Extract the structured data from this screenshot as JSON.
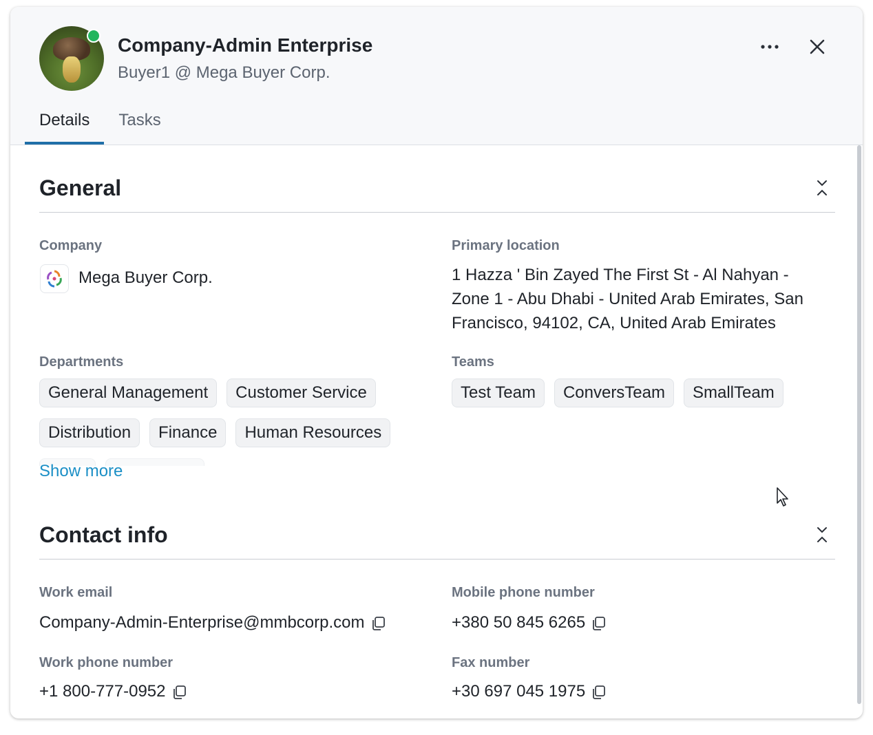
{
  "header": {
    "name": "Company-Admin Enterprise",
    "subtitle": "Buyer1 @ Mega Buyer Corp.",
    "status_color": "#23b55e"
  },
  "tabs": [
    {
      "label": "Details",
      "active": true
    },
    {
      "label": "Tasks",
      "active": false
    }
  ],
  "general": {
    "title": "General",
    "company_label": "Company",
    "company_value": "Mega Buyer Corp.",
    "location_label": "Primary location",
    "location_value": "1 Hazza ' Bin Zayed The First St - Al Nahyan - Zone 1 - Abu Dhabi - United Arab Emirates, San Francisco, 94102, CA, United Arab Emirates",
    "departments_label": "Departments",
    "departments": [
      "General Management",
      "Customer Service",
      "Distribution",
      "Finance",
      "Human Resources"
    ],
    "teams_label": "Teams",
    "teams": [
      "Test Team",
      "ConversTeam",
      "SmallTeam"
    ],
    "show_more": "Show more"
  },
  "contact": {
    "title": "Contact info",
    "work_email_label": "Work email",
    "work_email": "Company-Admin-Enterprise@mmbcorp.com",
    "mobile_label": "Mobile phone number",
    "mobile": "+380 50 845 6265",
    "work_phone_label": "Work phone number",
    "work_phone": "+1 800-777-0952",
    "fax_label": "Fax number",
    "fax": "+30 697 045 1975"
  },
  "colors": {
    "accent": "#1f6fa8",
    "link": "#1b8fc6"
  },
  "icons": [
    "more-horizontal-icon",
    "close-icon",
    "collapse-icon",
    "copy-icon",
    "company-logo-icon",
    "mouse-pointer-icon"
  ]
}
